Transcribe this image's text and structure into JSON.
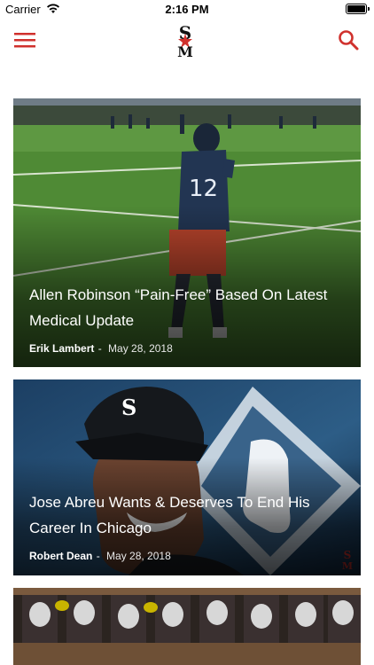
{
  "status_bar": {
    "carrier": "Carrier",
    "time": "2:16 PM"
  },
  "header": {
    "menu_icon": "hamburger-menu-icon",
    "logo_text": "SM",
    "search_icon": "search-icon",
    "accent": "#d0312d"
  },
  "articles": [
    {
      "title": "Allen Robinson “Pain-Free” Based On Latest Medical Update",
      "author": "Erik Lambert",
      "separator": "-",
      "date": "May 28, 2018"
    },
    {
      "title": "Jose Abreu Wants & Deserves To End His Career In Chicago",
      "author": "Robert Dean",
      "separator": "-",
      "date": "May 28, 2018"
    },
    {
      "title": "",
      "author": "",
      "separator": "",
      "date": ""
    }
  ]
}
